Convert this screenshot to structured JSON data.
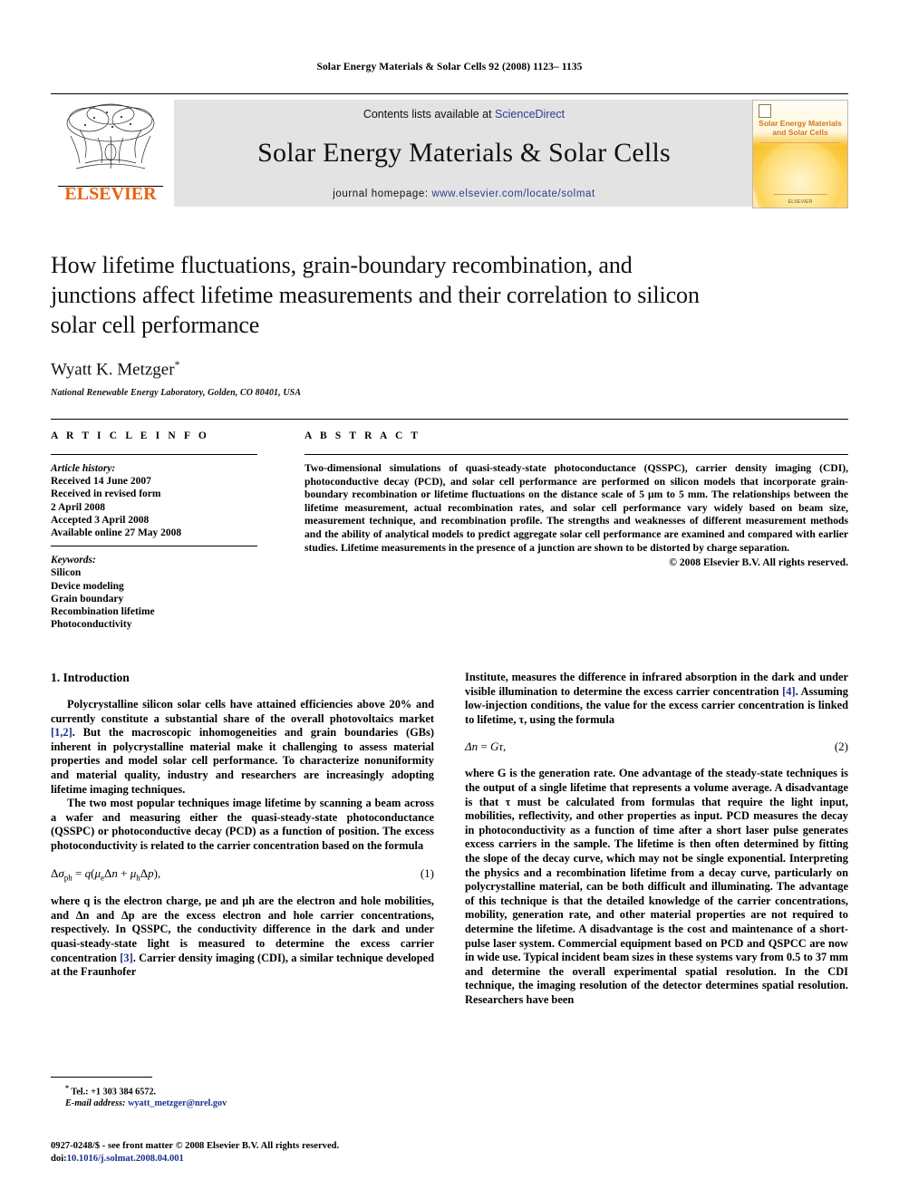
{
  "running_head": "Solar Energy Materials & Solar Cells 92 (2008) 1123– 1135",
  "banner": {
    "publisher_name": "ELSEVIER",
    "contents_prefix": "Contents lists available at ",
    "contents_link": "ScienceDirect",
    "journal_title": "Solar Energy Materials & Solar Cells",
    "homepage_prefix": "journal homepage: ",
    "homepage_url": "www.elsevier.com/locate/solmat",
    "cover": {
      "title_line1": "Solar Energy Materials",
      "title_line2": "and Solar Cells",
      "footer": "ELSEVIER"
    },
    "link_color": "#2b3f8c",
    "logo_color": "#E8620C"
  },
  "article": {
    "title": "How lifetime fluctuations, grain-boundary recombination, and junctions affect lifetime measurements and their correlation to silicon solar cell performance",
    "author": "Wyatt K. Metzger",
    "author_marker": "*",
    "affiliation": "National Renewable Energy Laboratory, Golden, CO 80401, USA"
  },
  "info": {
    "heading": "A R T I C L E   I N F O",
    "history_title": "Article history:",
    "history": [
      "Received 14 June 2007",
      "Received in revised form",
      "2 April 2008",
      "Accepted 3 April 2008",
      "Available online 27 May 2008"
    ],
    "keywords_title": "Keywords:",
    "keywords": [
      "Silicon",
      "Device modeling",
      "Grain boundary",
      "Recombination lifetime",
      "Photoconductivity"
    ]
  },
  "abstract": {
    "heading": "A B S T R A C T",
    "text": "Two-dimensional simulations of quasi-steady-state photoconductance (QSSPC), carrier density imaging (CDI), photoconductive decay (PCD), and solar cell performance are performed on silicon models that incorporate grain-boundary recombination or lifetime fluctuations on the distance scale of 5 μm to 5 mm. The relationships between the lifetime measurement, actual recombination rates, and solar cell performance vary widely based on beam size, measurement technique, and recombination profile. The strengths and weaknesses of different measurement methods and the ability of analytical models to predict aggregate solar cell performance are examined and compared with earlier studies. Lifetime measurements in the presence of a junction are shown to be distorted by charge separation.",
    "copyright": "© 2008 Elsevier B.V. All rights reserved."
  },
  "body": {
    "section1_heading": "1.  Introduction",
    "left_par1_a": "Polycrystalline silicon solar cells have attained efficiencies above 20% and currently constitute a substantial share of the overall photovoltaics market ",
    "left_par1_ref": "[1,2]",
    "left_par1_b": ". But the macroscopic inhomogeneities and grain boundaries (GBs) inherent in polycrystalline material make it challenging to assess material properties and model solar cell performance. To characterize nonuniformity and material quality, industry and researchers are increasingly adopting lifetime imaging techniques.",
    "left_par2": "The two most popular techniques image lifetime by scanning a beam across a wafer and measuring either the quasi-steady-state photoconductance (QSSPC) or photoconductive decay (PCD) as a function of position. The excess photoconductivity is related to the carrier concentration based on the formula",
    "eq1_text": "Δσph = q(μeΔn + μhΔp),",
    "eq1_number": "(1)",
    "left_par3_a": "where q is the electron charge, μe and μh are the electron and hole mobilities, and Δn and Δp are the excess electron and hole carrier concentrations, respectively. In QSSPC, the conductivity difference in the dark and under quasi-steady-state light is measured to determine the excess carrier concentration ",
    "left_par3_ref": "[3]",
    "left_par3_b": ". Carrier density imaging (CDI), a similar technique developed at the Fraunhofer",
    "right_par1_a": "Institute, measures the difference in infrared absorption in the dark and under visible illumination to determine the excess carrier concentration ",
    "right_par1_ref": "[4]",
    "right_par1_b": ". Assuming low-injection conditions, the value for the excess carrier concentration is linked to lifetime, τ, using the formula",
    "eq2_text": "Δn = Gτ,",
    "eq2_number": "(2)",
    "right_par2": "where G is the generation rate. One advantage of the steady-state techniques is the output of a single lifetime that represents a volume average. A disadvantage is that τ must be calculated from formulas that require the light input, mobilities, reflectivity, and other properties as input. PCD measures the decay in photoconductivity as a function of time after a short laser pulse generates excess carriers in the sample. The lifetime is then often determined by fitting the slope of the decay curve, which may not be single exponential. Interpreting the physics and a recombination lifetime from a decay curve, particularly on polycrystalline material, can be both difficult and illuminating. The advantage of this technique is that the detailed knowledge of the carrier concentrations, mobility, generation rate, and other material properties are not required to determine the lifetime. A disadvantage is the cost and maintenance of a short-pulse laser system. Commercial equipment based on PCD and QSPCC are now in wide use. Typical incident beam sizes in these systems vary from 0.5 to 37 mm and determine the overall experimental spatial resolution. In the CDI technique, the imaging resolution of the detector determines spatial resolution. Researchers have been"
  },
  "footnotes": {
    "tel_marker": "*",
    "tel": "Tel.: +1 303 384 6572.",
    "email_label": "E-mail address:",
    "email": "wyatt_metzger@nrel.gov",
    "imprint": "0927-0248/$ - see front matter © 2008 Elsevier B.V. All rights reserved.",
    "doi_label": "doi:",
    "doi": "10.1016/j.solmat.2008.04.001"
  }
}
